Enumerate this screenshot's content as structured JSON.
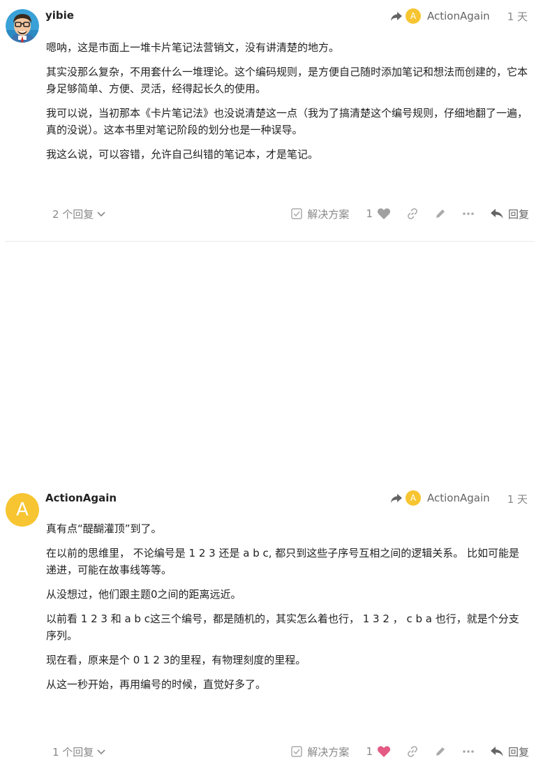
{
  "posts": [
    {
      "username": "yibie",
      "reply_to_user": "ActionAgain",
      "reply_to_avatar_letter": "A",
      "date": "1 天",
      "paragraphs": [
        "嗯呐，这是市面上一堆卡片笔记法营销文，没有讲清楚的地方。",
        "其实没那么复杂，不用套什么一堆理论。这个编码规则，是方便自己随时添加笔记和想法而创建的，它本身足够简单、方便、灵活，经得起长久的使用。",
        "我可以说，当初那本《卡片笔记法》也没说清楚这一点（我为了搞清楚这个编号规则，仔细地翻了一遍，真的没说）。这本书里对笔记阶段的划分也是一种误导。",
        "我这么说，可以容错，允许自己纠错的笔记本，才是笔记。"
      ],
      "replies_label": "2 个回复",
      "solution_label": "解决方案",
      "like_count": "1",
      "reply_label": "回复",
      "heart_color": "#a0a0a0"
    },
    {
      "username": "ActionAgain",
      "avatar_letter": "A",
      "reply_to_user": "ActionAgain",
      "reply_to_avatar_letter": "A",
      "date": "1 天",
      "paragraphs": [
        "真有点“醍醐灌顶”到了。",
        "在以前的思维里， 不论编号是 1 2 3 还是 a b c, 都只到这些子序号互相之间的逻辑关系。 比如可能是递进，可能在故事线等等。",
        "从没想过，他们跟主题0之间的距离远近。",
        "以前看 1 2 3 和 a b c这三个编号，都是随机的，其实怎么着也行， 1 3 2 ， c b a 也行，就是个分支序列。",
        "现在看，原来是个 0 1 2 3的里程，有物理刻度的里程。",
        "从这一秒开始，再用编号的时候，直觉好多了。"
      ],
      "replies_label": "1 个回复",
      "solution_label": "解决方案",
      "like_count": "1",
      "reply_label": "回复",
      "heart_color": "#e45a84"
    }
  ],
  "colors": {
    "avatar_bg": "#f7c531",
    "muted": "#888888",
    "liked_heart": "#e45a84"
  }
}
